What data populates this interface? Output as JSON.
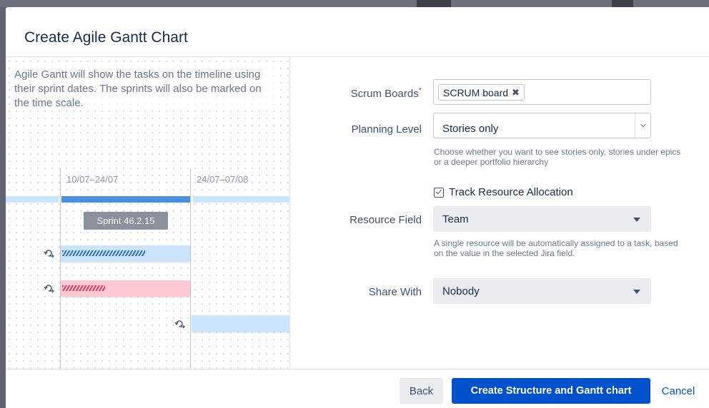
{
  "dialog": {
    "title": "Create Agile Gantt Chart"
  },
  "illustration": {
    "description_text": "Agile Gantt will show the tasks on the timeline using their sprint dates. The sprints will also be marked on the time scale.",
    "date_ranges": [
      "10/07–24/07",
      "24/07–07/08"
    ],
    "sprint_label": "Sprint 46.2.15"
  },
  "form": {
    "scrum_boards": {
      "label": "Scrum Boards",
      "required_marker": "*",
      "selected_chips": [
        "SCRUM board"
      ],
      "chip_remove_glyph": "✖"
    },
    "planning_level": {
      "label": "Planning Level",
      "value": "Stories only",
      "help": "Choose whether you want to see stories only, stories under epics or a deeper portfolio hierarchy"
    },
    "track_resource": {
      "label": "Track Resource Allocation",
      "checked": true
    },
    "resource_field": {
      "label": "Resource Field",
      "value": "Team",
      "help": "A single resource will be automatically assigned to a task, based on the value in the selected Jira field."
    },
    "share_with": {
      "label": "Share With",
      "value": "Nobody"
    }
  },
  "footer": {
    "back_label": "Back",
    "create_label": "Create Structure and Gantt chart",
    "cancel_label": "Cancel"
  },
  "colors": {
    "primary": "#0052cc",
    "timeline_blue": "#4a90e2",
    "timeline_light": "#cce5ff",
    "task_red": "#ffc9d3"
  },
  "icons": {
    "dependency": "dependency-arrow-icon",
    "chevron": "chevron-down-icon"
  }
}
